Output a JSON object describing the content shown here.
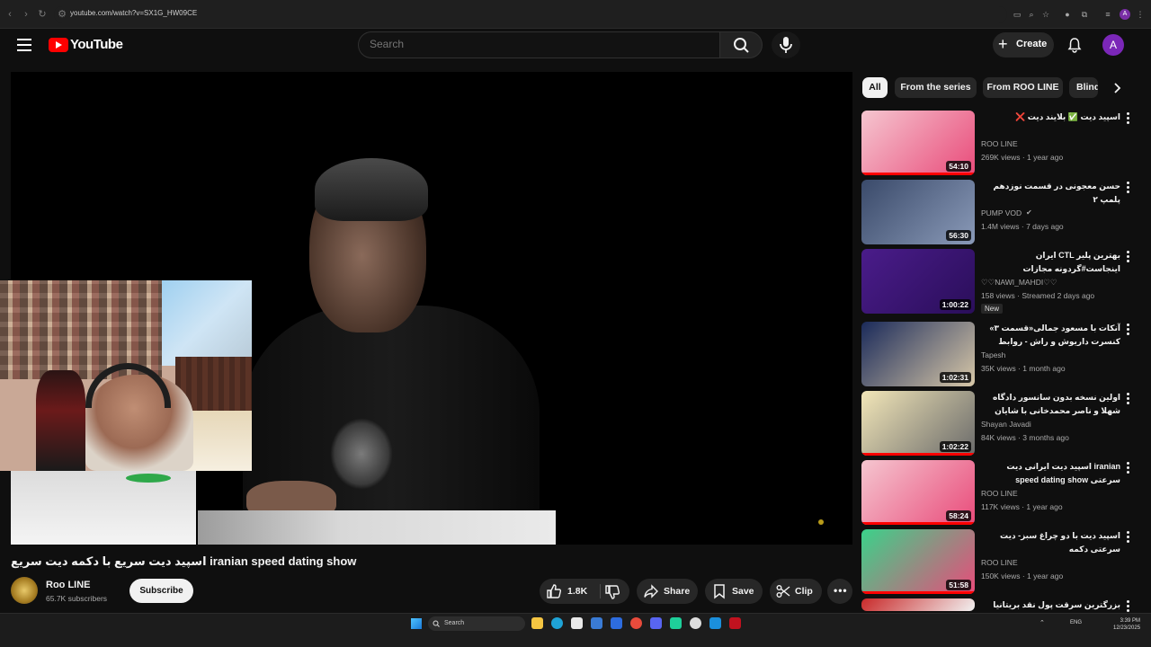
{
  "browser": {
    "url": "youtube.com/watch?v=SX1G_HW09CE"
  },
  "header": {
    "logo_text": "YouTube",
    "search_placeholder": "Search",
    "create_label": "Create",
    "avatar_letter": "A",
    "browser_avatar_letter": "A"
  },
  "video": {
    "title": "اسپید دیت سریع با دکمه دیت سریع iranian speed dating show",
    "channel": "Roo LINE",
    "subscribers": "65.7K subscribers",
    "subscribe_label": "Subscribe",
    "likes": "1.8K",
    "share_label": "Share",
    "save_label": "Save",
    "clip_label": "Clip"
  },
  "chips": [
    "All",
    "From the series",
    "From ROO LINE",
    "Blind"
  ],
  "recommendations": [
    {
      "title": "اسپید دیت ✅ بلایند دیت ❌",
      "channel": "ROO LINE",
      "meta": "269K views · 1 year ago",
      "duration": "54:10",
      "verified": false,
      "badge": "",
      "thumb_colors": [
        "#f5c6d0",
        "#e94b7a"
      ]
    },
    {
      "title": "حسن معجونی در قسمت نوزدهم پلمپ ۲",
      "channel": "PUMP VOD",
      "meta": "1.4M views · 7 days ago",
      "duration": "56:30",
      "verified": true,
      "badge": "",
      "thumb_colors": [
        "#3a4a6a",
        "#8a9ab8"
      ]
    },
    {
      "title": "بهترین پلیر CTL ایران اینجاست#گردونه مجازات Live_Stream#🔴",
      "channel": "♡♡NAWI_MAHDI♡♡",
      "meta": "158 views · Streamed 2 days ago",
      "duration": "1:00:22",
      "verified": false,
      "badge": "New",
      "thumb_colors": [
        "#4a1c8a",
        "#2a0e5a"
      ]
    },
    {
      "title": "آنکات با مسعود جمالی«قسمت ۳» کنسرت داریوش و راش - روابط خوانندگان با ...",
      "channel": "Tapesh",
      "meta": "35K views · 1 month ago",
      "duration": "1:02:31",
      "verified": false,
      "badge": "",
      "thumb_colors": [
        "#1a2a5a",
        "#d8c8a8"
      ]
    },
    {
      "title": "اولین نسخه بدون سانسور دادگاه شهلا و ناصر محمدخانی با شایان #مستند #جنایی ...",
      "channel": "Shayan Javadi",
      "meta": "84K views · 3 months ago",
      "duration": "1:02:22",
      "verified": false,
      "badge": "",
      "thumb_colors": [
        "#f2e6b8",
        "#6a6a6a"
      ]
    },
    {
      "title": "iranian اسپید دیت ایرانی دیت سرعتی speed dating show",
      "channel": "ROO LINE",
      "meta": "117K views · 1 year ago",
      "duration": "58:24",
      "verified": false,
      "badge": "",
      "thumb_colors": [
        "#f5c6d0",
        "#e94b7a"
      ]
    },
    {
      "title": "اسپید دیت با دو چراغ سبز- دیت سرعتی دکمه",
      "channel": "ROO LINE",
      "meta": "150K views · 1 year ago",
      "duration": "51:58",
      "verified": false,
      "badge": "",
      "thumb_colors": [
        "#3ad28a",
        "#e94b7a"
      ]
    },
    {
      "title": "بزرگترین سرقت پول نقد بریتانیا چگونه",
      "channel": "",
      "meta": "",
      "duration": "",
      "verified": false,
      "badge": "",
      "thumb_colors": [
        "#c92a2a",
        "#f1f1f1"
      ]
    }
  ],
  "taskbar": {
    "search_label": "Search",
    "lang": "ENG",
    "time": "3:39 PM",
    "date": "12/23/2025"
  },
  "colors": {
    "accent_red": "#ff0000",
    "background": "#0f0f0f",
    "avatar": "#7b27b8"
  }
}
